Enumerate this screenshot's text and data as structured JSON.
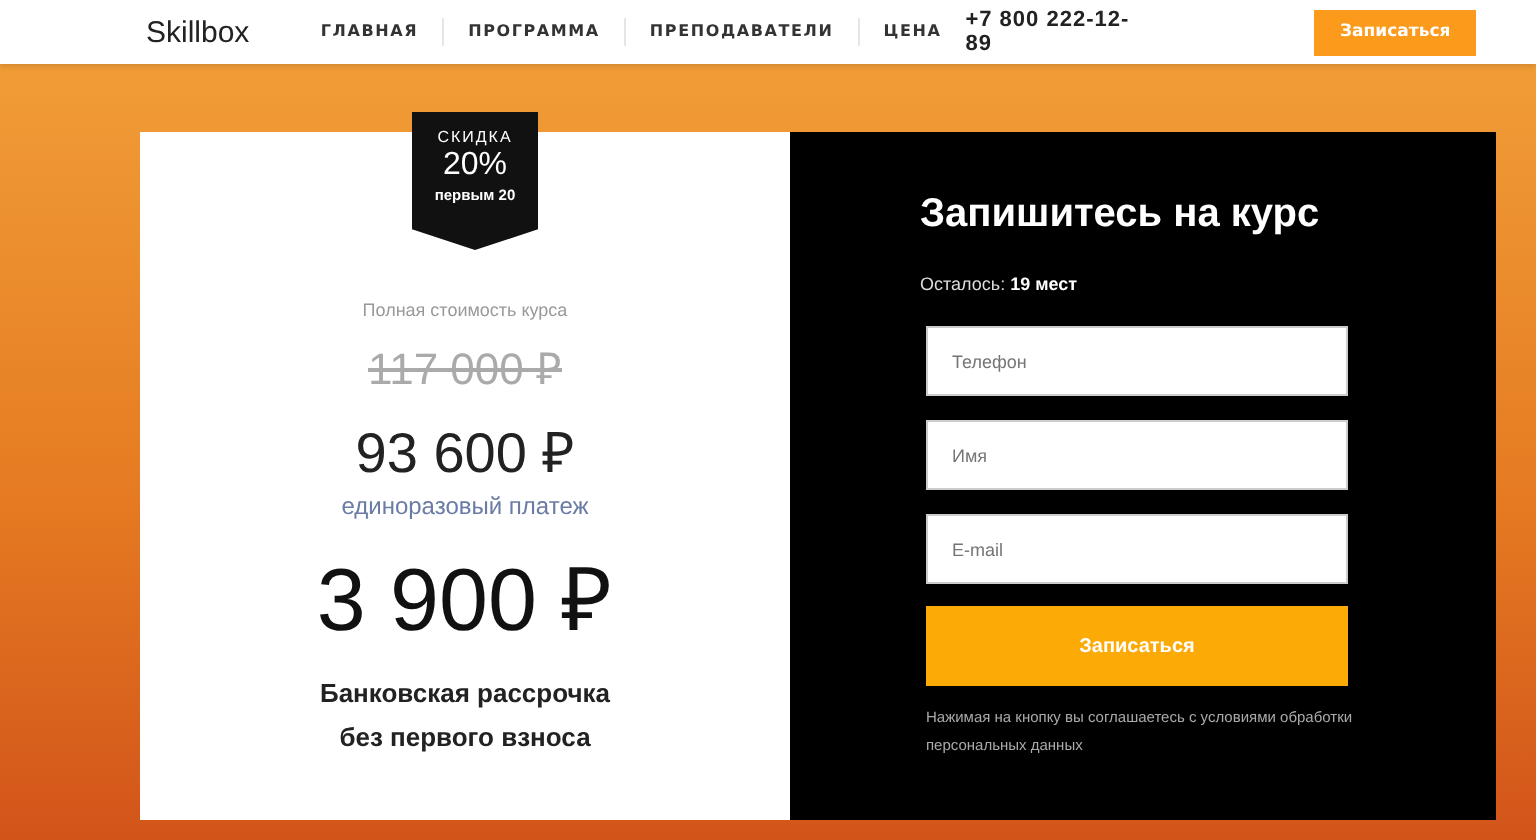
{
  "header": {
    "logo": "Skillbox",
    "nav": [
      {
        "label": "ГЛАВНАЯ"
      },
      {
        "label": "ПРОГРАММА"
      },
      {
        "label": "ПРЕПОДАВАТЕЛИ"
      },
      {
        "label": "ЦЕНА"
      }
    ],
    "phone": "+7 800 222-12-89",
    "cta": "Записаться"
  },
  "price": {
    "badge": {
      "title": "СКИДКА",
      "value": "20%",
      "note": "первым 20"
    },
    "full_label": "Полная стоимость курса",
    "old_price": "117 000 ₽",
    "price": "93 600 ₽",
    "price_note": "единоразовый платеж",
    "monthly": "3 900 ₽",
    "installment": [
      "Банковская рассрочка",
      "без первого взноса"
    ]
  },
  "form": {
    "title": "Запишитесь на курс",
    "remaining": "Осталось: **19 мест**",
    "fields": [
      {
        "placeholder": "Телефон"
      },
      {
        "placeholder": "Имя"
      },
      {
        "placeholder": "E-mail"
      }
    ],
    "submit": "Записаться",
    "consent": "Нажимая на кнопку вы соглашаетесь с условиями обработки персональных данных"
  }
}
